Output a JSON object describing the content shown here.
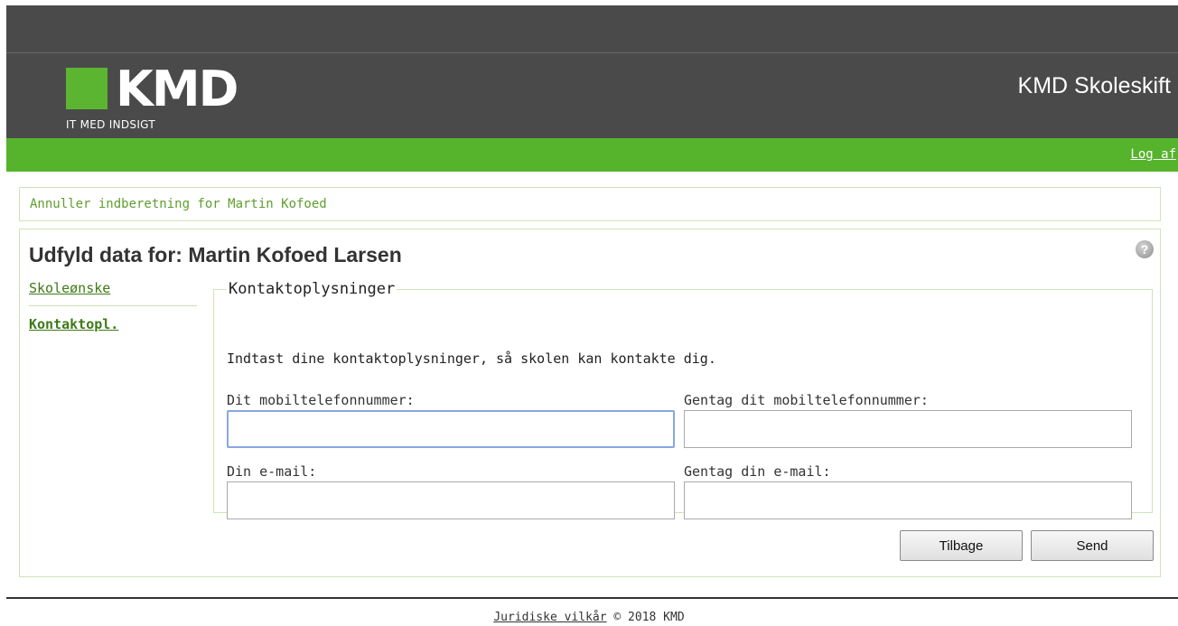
{
  "header": {
    "logo_text": "KMD",
    "logo_tagline": "IT MED INDSIGT",
    "app_title": "KMD Skoleskift",
    "logout_label": "Log af"
  },
  "cancel_link": "Annuller indberetning for Martin Kofoed",
  "page_title": "Udfyld data for: Martin Kofoed Larsen",
  "help_icon": "?",
  "nav": {
    "items": [
      {
        "label": "Skoleønske",
        "active": false
      },
      {
        "label": "Kontaktopl.",
        "active": true
      }
    ]
  },
  "contact": {
    "legend": "Kontaktoplysninger",
    "instructions": "Indtast dine kontaktoplysninger, så skolen kan kontakte dig.",
    "fields": [
      {
        "label": "Dit mobiltelefonnummer:",
        "value": ""
      },
      {
        "label": "Gentag dit mobiltelefonnummer:",
        "value": ""
      },
      {
        "label": "Din e-mail:",
        "value": ""
      },
      {
        "label": "Gentag din e-mail:",
        "value": ""
      }
    ]
  },
  "buttons": {
    "back": "Tilbage",
    "send": "Send"
  },
  "footer": {
    "link": "Juridiske vilkår",
    "copyright": "© 2018 KMD"
  },
  "colors": {
    "header_bg": "#4a4a4a",
    "brand_green": "#55b32c",
    "link_green": "#3d7a17",
    "border_green": "#cfe3b9"
  }
}
